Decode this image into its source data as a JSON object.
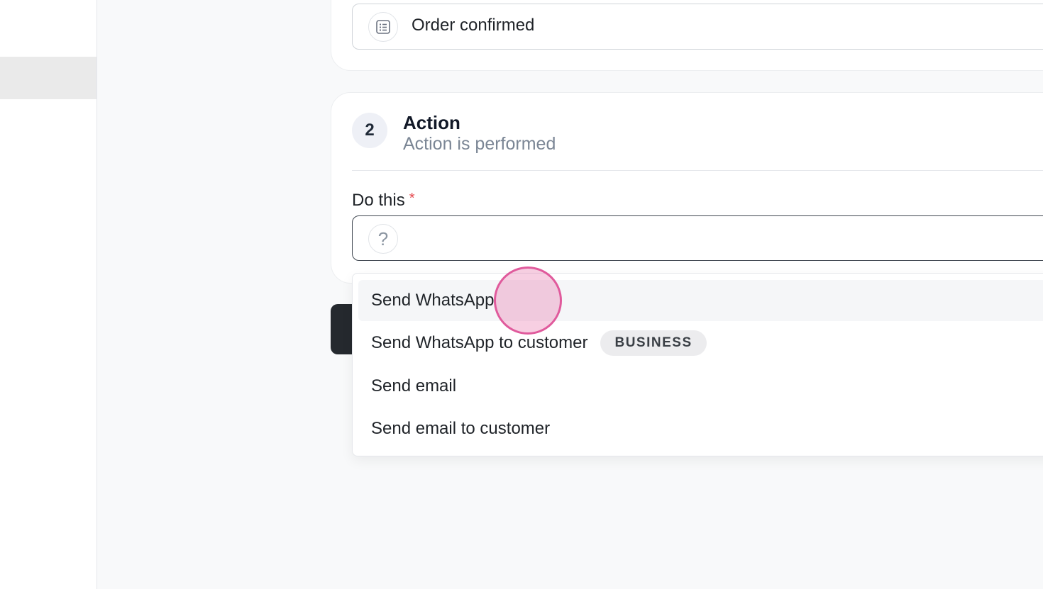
{
  "trigger": {
    "value": "Order confirmed",
    "icon": "list-icon"
  },
  "action_step": {
    "number": "2",
    "title": "Action",
    "subtitle": "Action is performed"
  },
  "do_this": {
    "label": "Do this",
    "required_mark": "*",
    "placeholder_icon": "question-icon",
    "placeholder_glyph": "?"
  },
  "dropdown": {
    "options": [
      {
        "label": "Send WhatsApp",
        "badge": ""
      },
      {
        "label": "Send WhatsApp to customer",
        "badge": "BUSINESS"
      },
      {
        "label": "Send email",
        "badge": ""
      },
      {
        "label": "Send email to customer",
        "badge": ""
      }
    ]
  },
  "colors": {
    "required": "#e5484d",
    "cursor": "#e05a9c",
    "primary_button": "#25292e"
  }
}
